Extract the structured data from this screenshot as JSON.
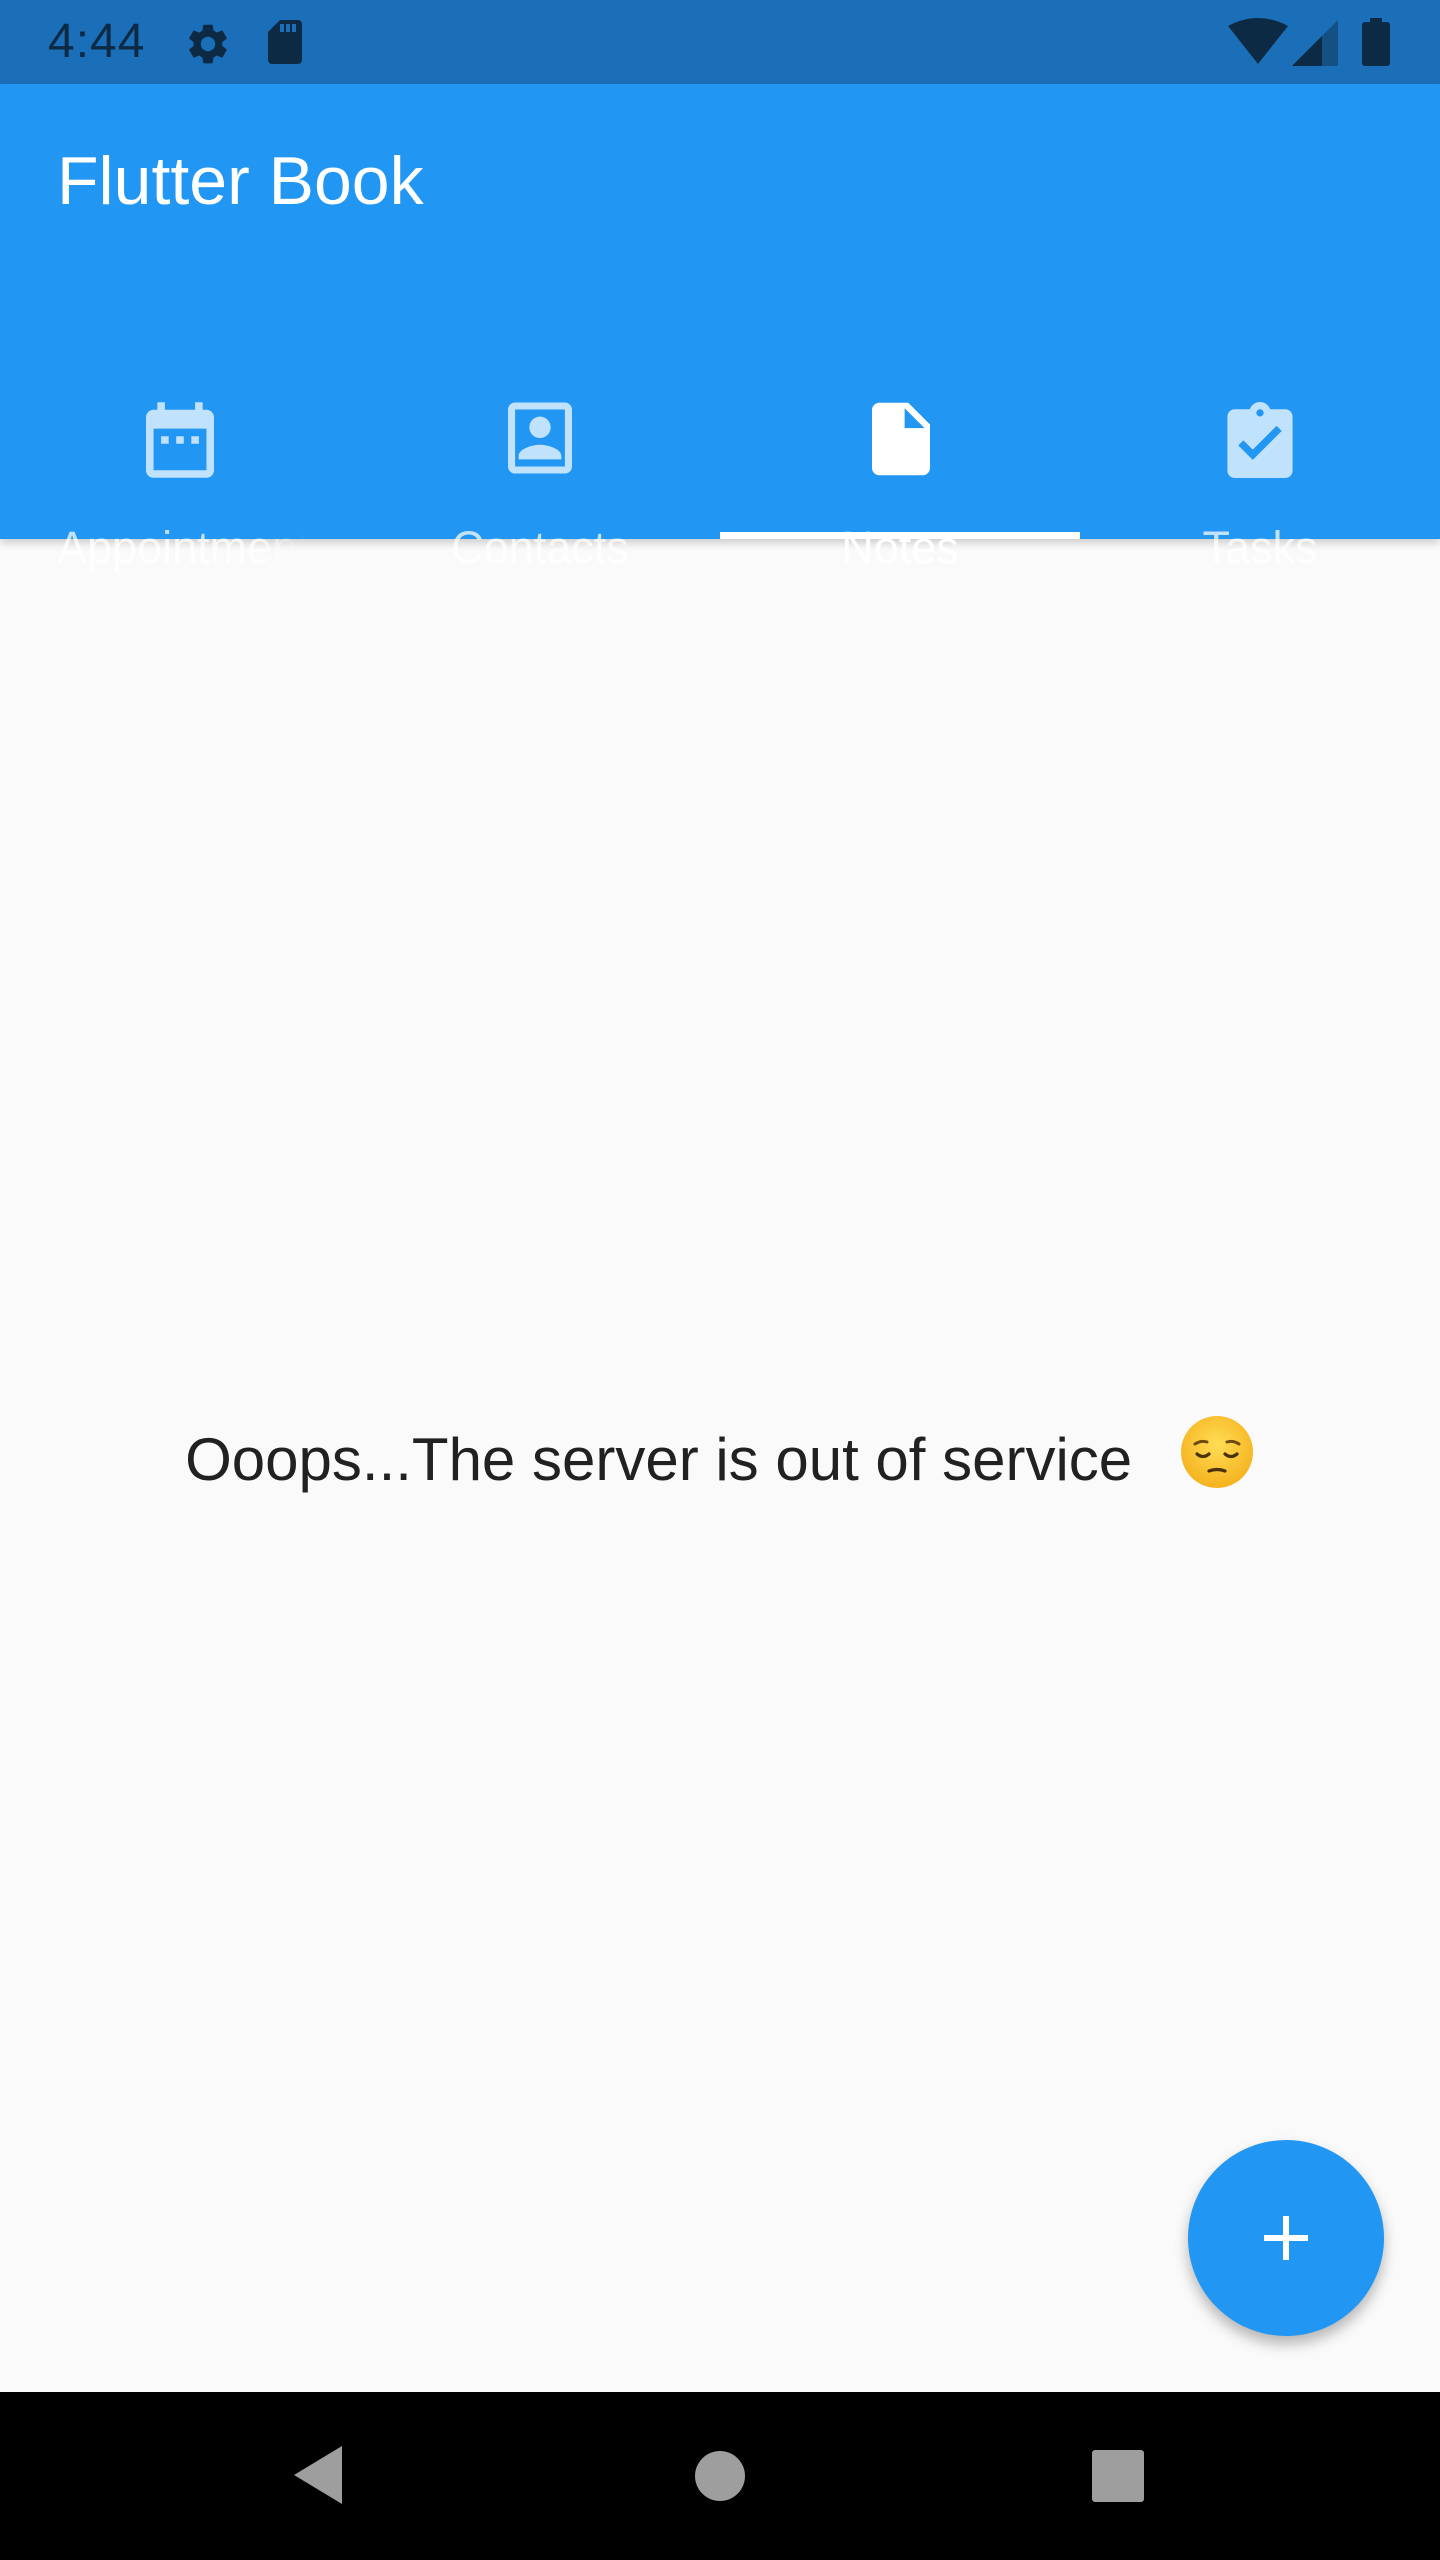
{
  "status_bar": {
    "time": "4:44",
    "icons": [
      "settings-icon",
      "sd-card-icon",
      "wifi-icon",
      "cellular-signal-icon",
      "battery-icon"
    ]
  },
  "app_bar": {
    "title": "Flutter Book",
    "tabs": [
      {
        "label": "Appointments",
        "icon": "calendar-icon",
        "active": false
      },
      {
        "label": "Contacts",
        "icon": "contact-card-icon",
        "active": false
      },
      {
        "label": "Notes",
        "icon": "note-icon",
        "active": true
      },
      {
        "label": "Tasks",
        "icon": "clipboard-check-icon",
        "active": false
      }
    ]
  },
  "content": {
    "error_message": "Ooops...The server is out of service",
    "emoji": "pensive-face-emoji"
  },
  "fab": {
    "icon": "plus-icon"
  },
  "navigation_bar": {
    "buttons": [
      "back-icon",
      "home-icon",
      "recents-icon"
    ]
  },
  "colors": {
    "primary": "#2196f3",
    "status_bar": "#1b6fb8",
    "background": "#fafafa",
    "text": "#212121"
  }
}
